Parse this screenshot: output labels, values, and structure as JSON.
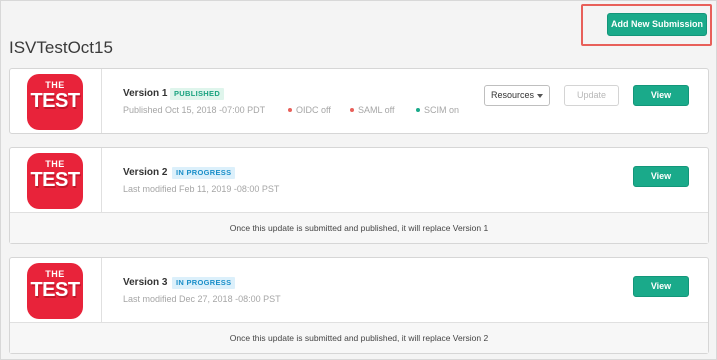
{
  "header": {
    "add_button_label": "Add New Submission",
    "page_title": "ISVTestOct15"
  },
  "logo": {
    "top_text": "THE",
    "main_text": "TEST",
    "color": "#e8233a"
  },
  "colors": {
    "accent": "#1aaa8a",
    "highlight": "#e8605a",
    "status_off": "#e8605a",
    "status_on": "#1aaa8a"
  },
  "versions": [
    {
      "title": "Version 1",
      "badge": "PUBLISHED",
      "meta": "Published Oct 15, 2018 -07:00 PDT",
      "statuses": [
        {
          "label": "OIDC off",
          "state": "off"
        },
        {
          "label": "SAML off",
          "state": "off"
        },
        {
          "label": "SCIM on",
          "state": "on"
        }
      ],
      "resources_label": "Resources",
      "update_label": "Update",
      "view_label": "View"
    },
    {
      "title": "Version 2",
      "badge": "IN PROGRESS",
      "meta": "Last modified Feb 11, 2019 -08:00 PST",
      "view_label": "View",
      "note": "Once this update is submitted and published, it will replace Version 1"
    },
    {
      "title": "Version 3",
      "badge": "IN PROGRESS",
      "meta": "Last modified Dec 27, 2018 -08:00 PST",
      "view_label": "View",
      "note": "Once this update is submitted and published, it will replace Version 2"
    }
  ]
}
